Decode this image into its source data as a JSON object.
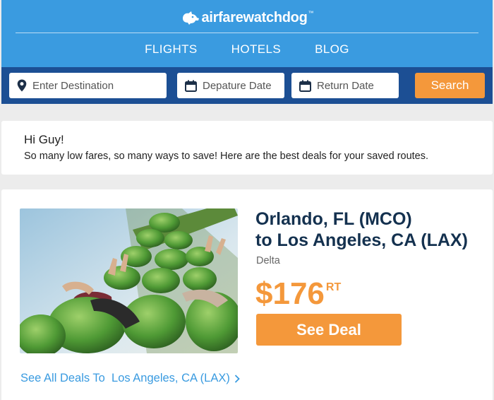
{
  "header": {
    "logo_text": "airfarewatchdog",
    "logo_tm": "™",
    "logo_icon": "dog-icon",
    "nav": [
      "FLIGHTS",
      "HOTELS",
      "BLOG"
    ]
  },
  "search": {
    "destination_placeholder": "Enter Destination",
    "departure_placeholder": "Depature Date",
    "return_placeholder": "Return Date",
    "button": "Search",
    "icons": [
      "location-pin-icon",
      "calendar-icon",
      "calendar-icon"
    ]
  },
  "greeting": {
    "hello": "Hi Guy!",
    "message": "So many low fares, so many ways to save! Here are the best deals for your saved routes."
  },
  "deal": {
    "route_line1": "Orlando, FL (MCO)",
    "route_line2": "to Los Angeles, CA (LAX)",
    "airline": "Delta",
    "price": "$176",
    "price_suffix": "RT",
    "button": "See Deal",
    "see_all": "See All Deals To  Los Angeles, CA (LAX)"
  },
  "colors": {
    "header_blue": "#3a9be0",
    "search_navy": "#1c4f94",
    "accent_orange": "#f4983b",
    "route_navy": "#14314f"
  }
}
